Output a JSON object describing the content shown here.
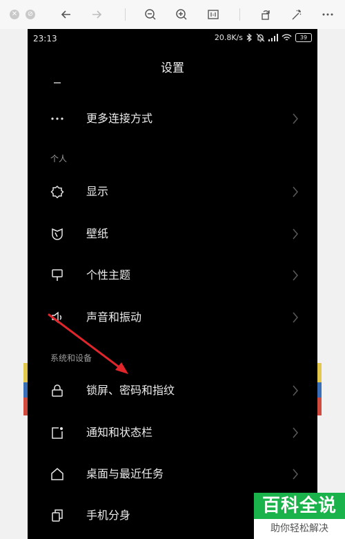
{
  "toolbar": {
    "buttons": [
      "back-icon",
      "forward-icon",
      "zoom-out-icon",
      "zoom-in-icon",
      "actual-size-icon",
      "rotate-icon",
      "magic-wand-icon",
      "more-icon"
    ]
  },
  "status_bar": {
    "time": "23:13",
    "net_speed": "20.8K/s",
    "battery": "39"
  },
  "page": {
    "title": "设置"
  },
  "sections": {
    "personal": "个人",
    "system": "系统和设备"
  },
  "items": [
    {
      "label": "更多连接方式",
      "icon": "more-dots-icon"
    },
    {
      "label": "显示",
      "icon": "brightness-icon"
    },
    {
      "label": "壁纸",
      "icon": "wallpaper-icon"
    },
    {
      "label": "个性主题",
      "icon": "theme-brush-icon"
    },
    {
      "label": "声音和振动",
      "icon": "speaker-icon"
    },
    {
      "label": "锁屏、密码和指纹",
      "icon": "lock-icon"
    },
    {
      "label": "通知和状态栏",
      "icon": "notification-icon"
    },
    {
      "label": "桌面与最近任务",
      "icon": "home-icon"
    },
    {
      "label": "手机分身",
      "icon": "dual-phone-icon"
    }
  ],
  "annotation": {
    "arrow_color": "#e0262b"
  },
  "watermark": {
    "title": "百科全说",
    "subtitle": "助你轻松解决",
    "color": "#19b24b"
  }
}
